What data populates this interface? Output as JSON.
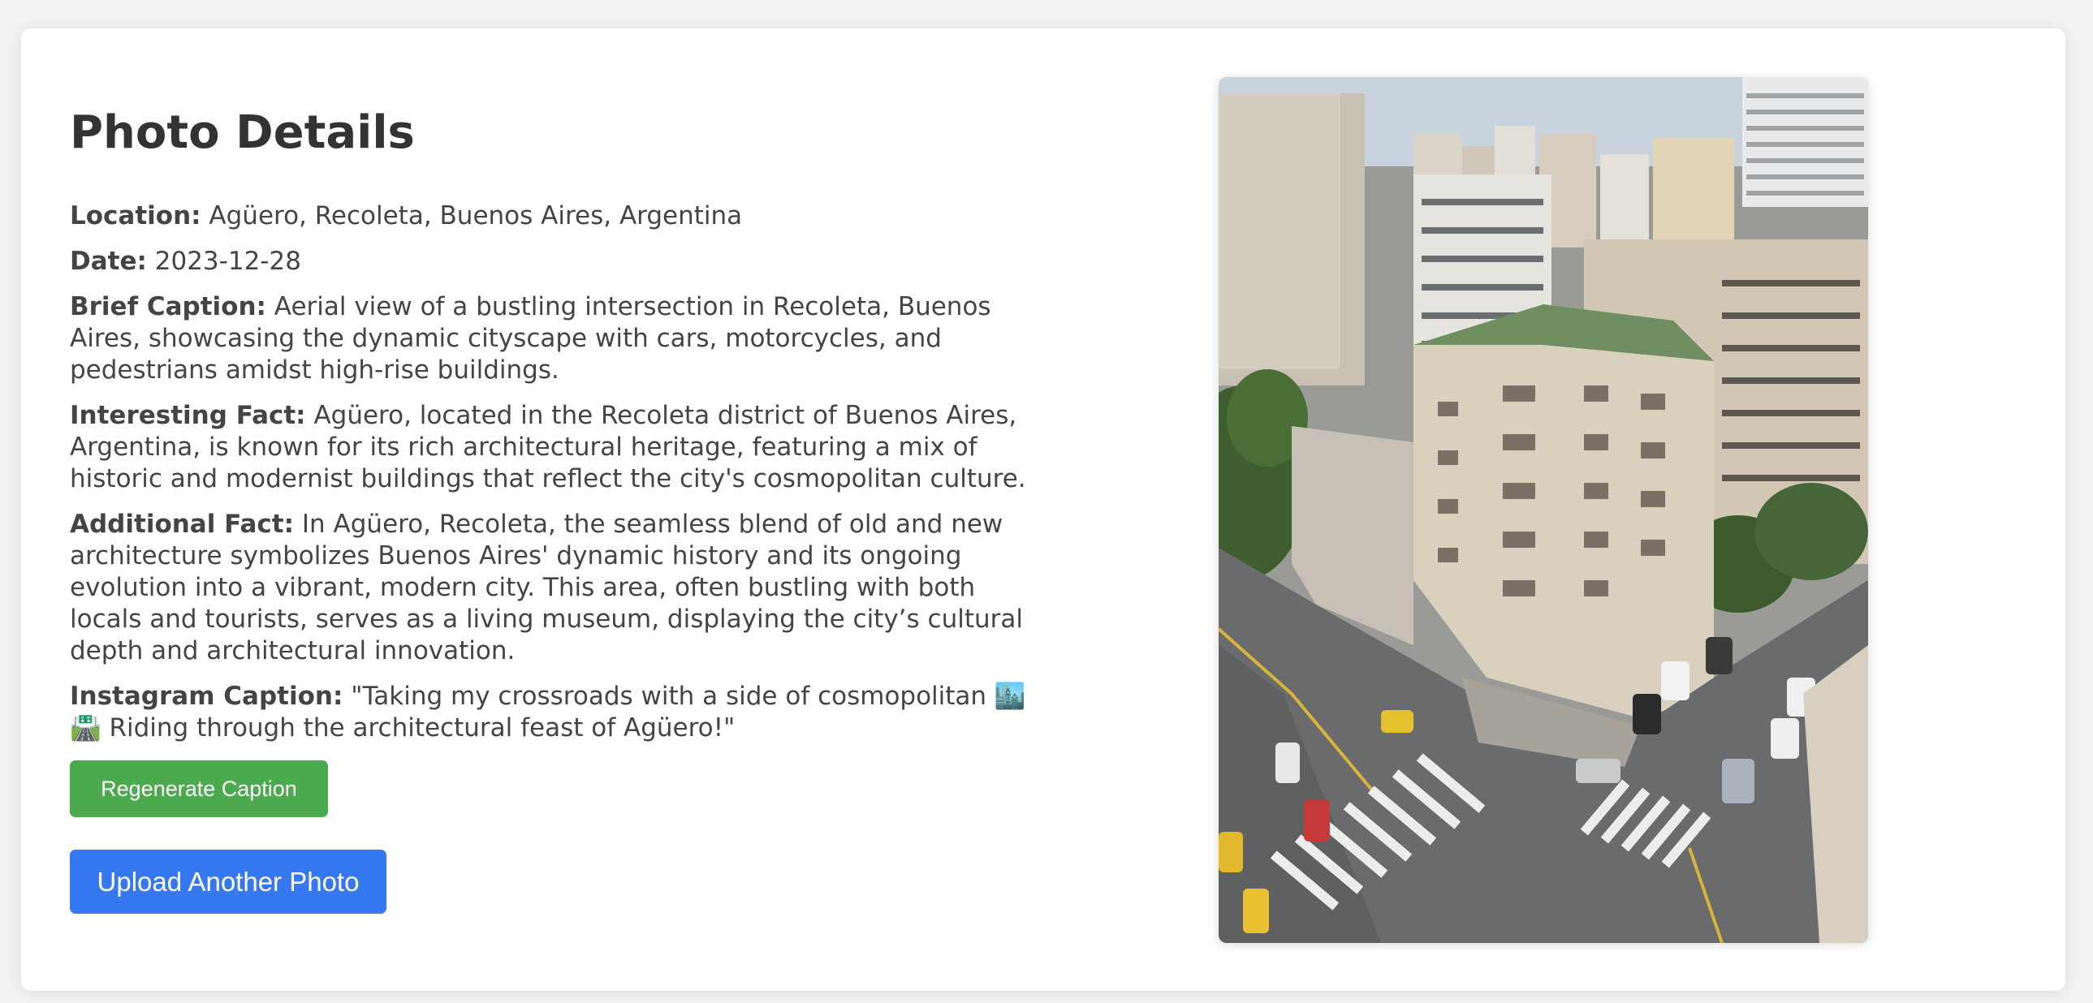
{
  "page": {
    "title": "Photo Details"
  },
  "details": {
    "location_label": "Location:",
    "location_value": "Agüero, Recoleta, Buenos Aires, Argentina",
    "date_label": "Date:",
    "date_value": "2023-12-28",
    "brief_caption_label": "Brief Caption:",
    "brief_caption_value": "Aerial view of a bustling intersection in Recoleta, Buenos Aires, showcasing the dynamic cityscape with cars, motorcycles, and pedestrians amidst high-rise buildings.",
    "interesting_fact_label": "Interesting Fact:",
    "interesting_fact_value": "Agüero, located in the Recoleta district of Buenos Aires, Argentina, is known for its rich architectural heritage, featuring a mix of historic and modernist buildings that reflect the city's cosmopolitan culture.",
    "additional_fact_label": "Additional Fact:",
    "additional_fact_value": "In Agüero, Recoleta, the seamless blend of old and new architecture symbolizes Buenos Aires' dynamic history and its ongoing evolution into a vibrant, modern city. This area, often bustling with both locals and tourists, serves as a living museum, displaying the city’s cultural depth and architectural innovation.",
    "instagram_caption_label": "Instagram Caption:",
    "instagram_caption_value": "\"Taking my crossroads with a side of cosmopolitan 🏙️🛣️ Riding through the architectural feast of Agüero!\""
  },
  "buttons": {
    "regenerate_label": "Regenerate Caption",
    "upload_label": "Upload Another Photo"
  },
  "colors": {
    "regenerate_button": "#4caa4e",
    "upload_button": "#3678f0",
    "page_background": "#f3f3f3",
    "card_background": "#ffffff"
  }
}
